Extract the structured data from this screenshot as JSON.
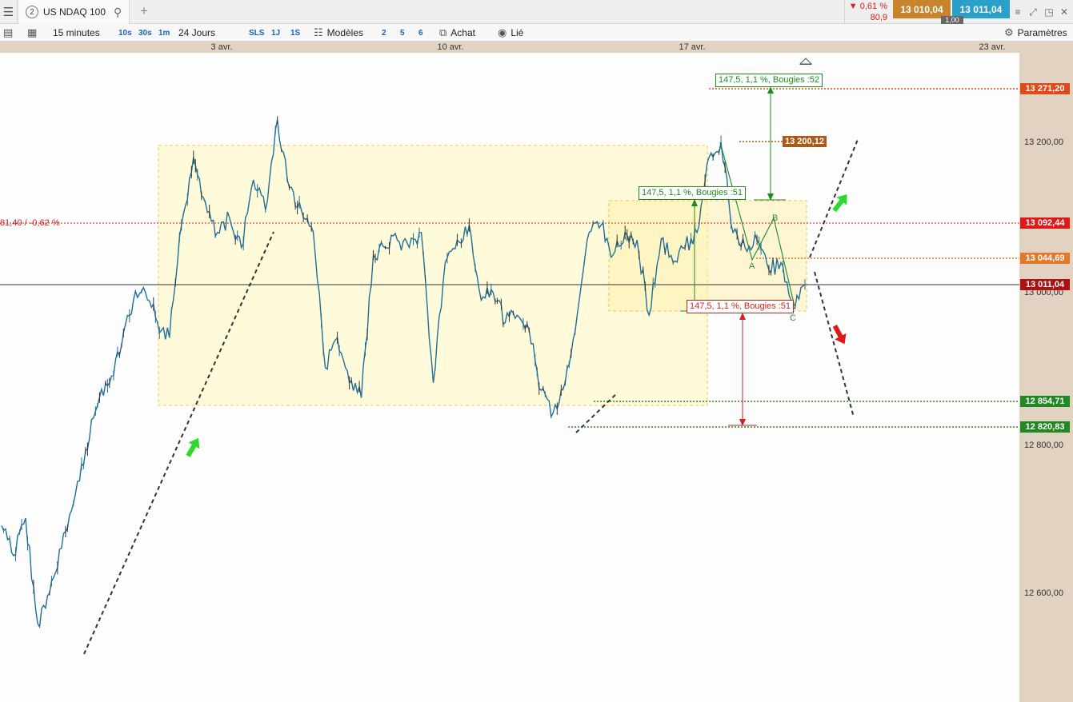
{
  "tabbar": {
    "tab_number": "2",
    "instrument": "US NDAQ 100",
    "change_pct": "▼ 0,61 %",
    "change_pts": "80,9",
    "bid": "13 010,04",
    "ask": "13 011,04",
    "spread": "1,00"
  },
  "toolbar": {
    "interval": "15 minutes",
    "q_10s": "10s",
    "q_30s": "30s",
    "q_1m": "1m",
    "range": "24 Jours",
    "q_sls": "SLS",
    "q_1j": "1J",
    "q_1s": "1S",
    "models": "Modèles",
    "n2": "2",
    "n5": "5",
    "n6": "6",
    "buy": "Achat",
    "link": "Lié",
    "settings": "Paramètres"
  },
  "chart_data": {
    "type": "line",
    "instrument": "US NDAQ 100",
    "interval": "15 minutes",
    "x_labels": [
      "3 avr.",
      "10 avr.",
      "17 avr.",
      "23 avr."
    ],
    "y_ticks": [
      "13 200,00",
      "13 000,00",
      "12 800,00",
      "12 600,00"
    ],
    "ylim": [
      12540,
      13300
    ],
    "series": [
      {
        "values": [
          12690,
          12650,
          12700,
          12560,
          12600,
          12660,
          12720,
          12790,
          12850,
          12880,
          12930,
          12990,
          13000,
          12960,
          12940,
          13090,
          13180,
          13120,
          13080,
          13100,
          13060,
          13150,
          13110,
          13230,
          13140,
          13110,
          13080,
          12900,
          12940,
          12880,
          12860,
          13050,
          13060,
          13070,
          13060,
          13080,
          12880,
          13040,
          13070,
          13090,
          12990,
          13000,
          12960,
          12970,
          12950,
          12870,
          12840,
          12880,
          12970,
          13080,
          13090,
          13050,
          13080,
          13070,
          12970,
          13070,
          13040,
          13060,
          13080,
          13180,
          13200,
          13080,
          13060,
          13070,
          13030,
          13040,
          12980,
          13011
        ]
      }
    ],
    "price_tags": {
      "target_top": "13 271,20",
      "level_mid": "13 200,12",
      "prev_close": "13 092,44",
      "level_b": "13 044,69",
      "current": "13 011,04",
      "support_1": "12 854,71",
      "support_2": "12 820,83"
    },
    "prev_close_note": "81,40 / -0,62 %",
    "measure_labels": [
      "147,5, 1,1 %, Bougies :52",
      "147,5, 1,1 %, Bougies :51",
      "147,5, 1,1 %, Bougies :51"
    ],
    "wave_labels": [
      "A",
      "B",
      "C"
    ],
    "colors": {
      "price_line": "#1f6f9a",
      "candle_dark": "#333333",
      "range_box": "#fff8cc",
      "bullish": "#2fd82f",
      "bearish": "#e01818",
      "measure_green": "#1f8a1f",
      "measure_red": "#d42020"
    }
  }
}
